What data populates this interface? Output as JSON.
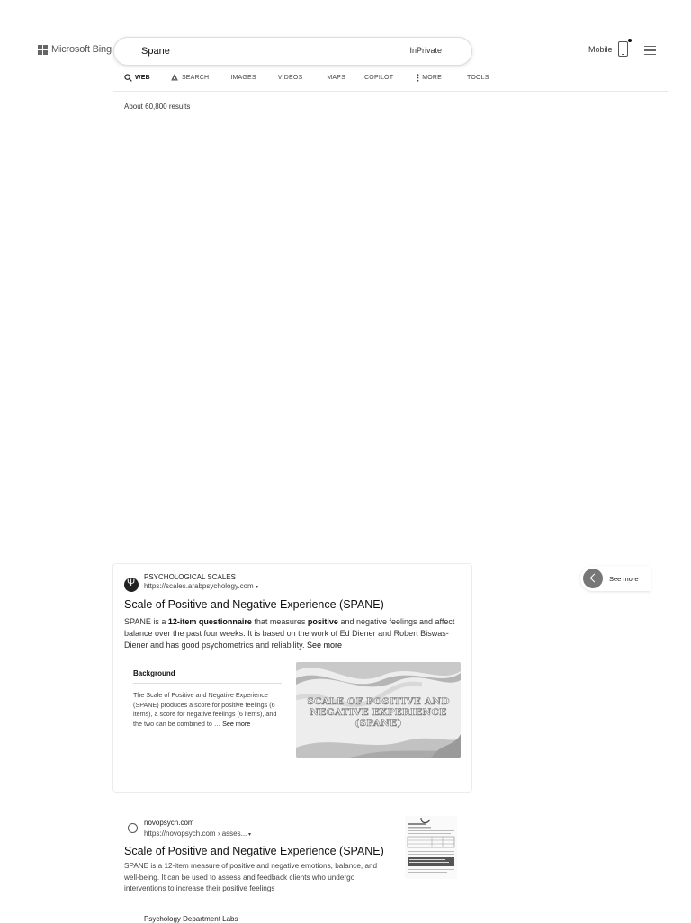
{
  "header": {
    "brand": "Microsoft Bing",
    "search_value": "Spane",
    "inprivate_label": "InPrivate",
    "mobile_label": "Mobile"
  },
  "nav": {
    "tabs": [
      {
        "label": "WEB",
        "icon": "search-icon",
        "active": true
      },
      {
        "label": "SEARCH",
        "icon": "copilot-search-icon",
        "active": false
      },
      {
        "label": "IMAGES",
        "active": false
      },
      {
        "label": "VIDEOS",
        "active": false
      },
      {
        "label": "MAPS",
        "active": false
      },
      {
        "label": "COPILOT",
        "active": false
      },
      {
        "label": "MORE",
        "icon": "vertical-dots-icon",
        "active": false
      },
      {
        "label": "TOOLS",
        "active": false
      }
    ]
  },
  "results_count": "About 60,800 results",
  "result1": {
    "site_name": "PSYCHOLOGICAL SCALES",
    "url": "https://scales.arabpsychology.com",
    "title": "Scale of Positive and Negative Experience (SPANE)",
    "snippet_parts": {
      "a": "SPANE is a ",
      "b": "12-item questionnaire",
      "c": " that measures ",
      "d": "positive",
      "e": " and negative feelings and affect balance over the past four weeks. It is based on the work of Ed Diener and Robert Biswas-Diener and has good psychometrics and reliability. ",
      "see_more": "See more"
    },
    "background_title": "Background",
    "background_text": "The Scale of Positive and Negative Experience (SPANE) produces a score for positive feelings (6 items), a score for negative feelings (6 items), and the two can be combined to … ",
    "background_see_more": "See more",
    "thumb_text": "SCALE OF POSITIVE AND NEGATIVE EXPERIENCE (SPANE)"
  },
  "side": {
    "see_more_label": "See more"
  },
  "result2": {
    "site_name": "novopsych.com",
    "url": "https://novopsych.com › asses...",
    "title": "Scale of Positive and Negative Experience (SPANE)",
    "snippet": "SPANE is a 12-item measure of positive and negative emotions, balance, and well-being. It can be used to assess and feedback clients who undergo interventions to increase their positive feelings"
  },
  "result3": {
    "site_name": "Psychology Department Labs"
  },
  "colors": {
    "text": "#222222",
    "border": "#ececec"
  }
}
